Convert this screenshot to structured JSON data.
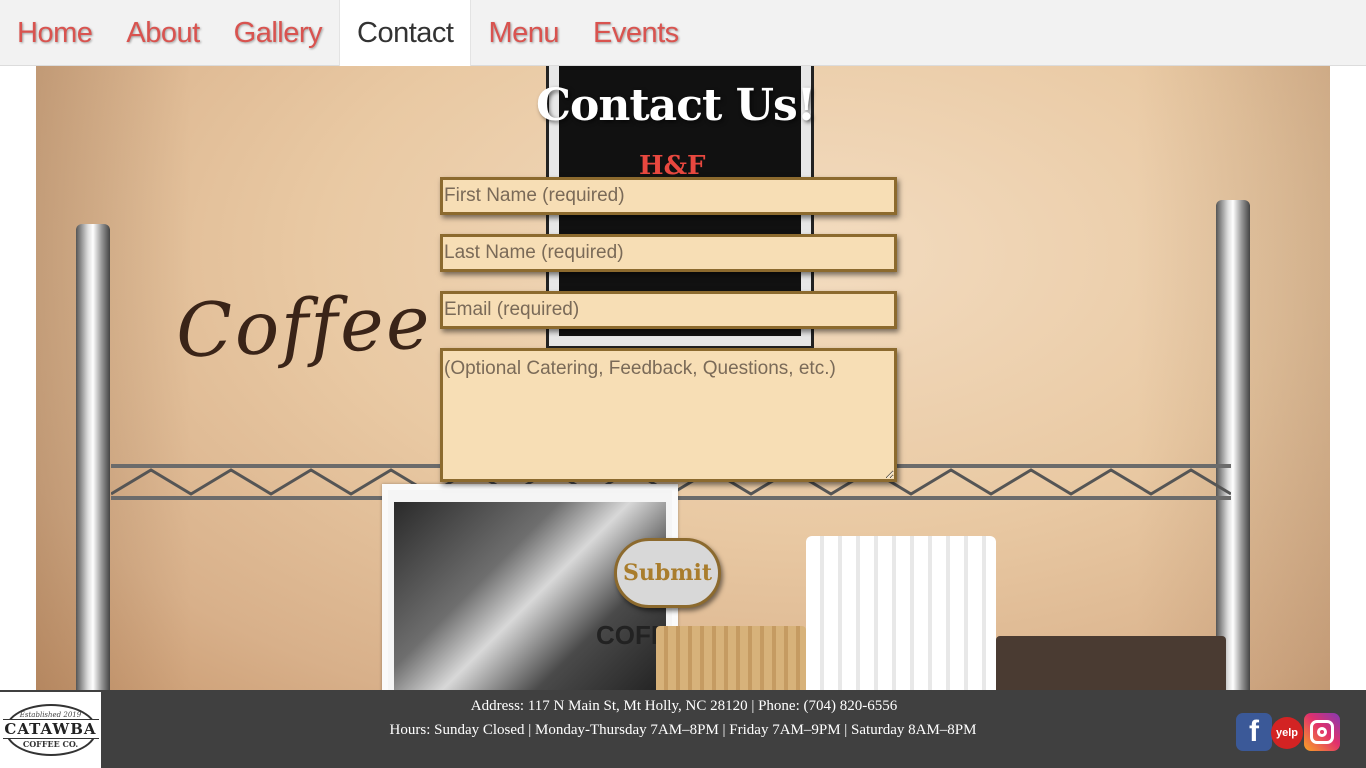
{
  "nav": {
    "items": [
      {
        "label": "Home"
      },
      {
        "label": "About"
      },
      {
        "label": "Gallery"
      },
      {
        "label": "Contact"
      },
      {
        "label": "Menu"
      },
      {
        "label": "Events"
      }
    ],
    "active": "Contact"
  },
  "hero": {
    "sign_text": "H&F",
    "wall_word": "Coffee",
    "card_label": "COFFEE"
  },
  "form": {
    "title": "Contact Us!",
    "first_name_placeholder": "First Name (required)",
    "last_name_placeholder": "Last Name (required)",
    "email_placeholder": "Email (required)",
    "message_placeholder": "(Optional Catering, Feedback, Questions, etc.)",
    "submit_label": "Submit"
  },
  "footer": {
    "logo": {
      "established": "Established 2019",
      "name": "CATAWBA",
      "subtitle": "COFFEE CO."
    },
    "address": "Address: 117 N Main St, Mt Holly, NC 28120 | Phone: (704) 820-6556",
    "hours": "Hours: Sunday Closed | Monday-Thursday 7AM–8PM | Friday 7AM–9PM | Saturday 8AM–8PM",
    "social": {
      "facebook": "f",
      "yelp": "yelp",
      "instagram_icon": "instagram-icon"
    }
  },
  "colors": {
    "nav_link": "#d9534f",
    "field_bg": "#f7deb5",
    "field_border": "#8c6a2e",
    "submit_text": "#a97d2d"
  }
}
